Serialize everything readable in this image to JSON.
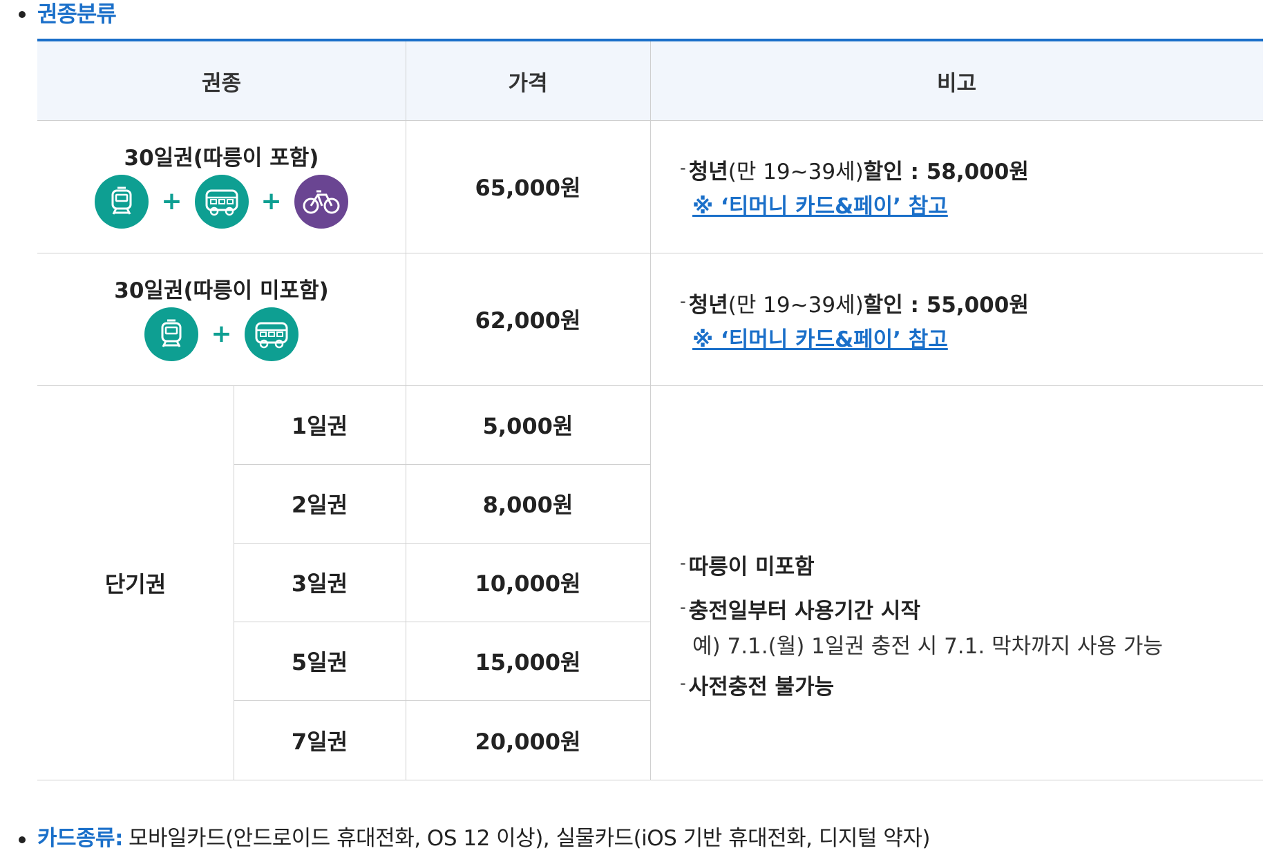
{
  "section": {
    "title": "권종분류"
  },
  "table": {
    "headers": [
      "권종",
      "가격",
      "비고"
    ],
    "rows": [
      {
        "name": "30일권(따릉이 포함)",
        "price": "65,000원",
        "icons": [
          "subway-icon",
          "bus-icon",
          "bicycle-icon"
        ],
        "note_prefix": "청년",
        "note_paren": "(만 19~39세)",
        "note_suffix": "할인 : 58,000원",
        "note_link": "※ ‘티머니 카드&페이’ 참고"
      },
      {
        "name": "30일권(따릉이 미포함)",
        "price": "62,000원",
        "icons": [
          "subway-icon",
          "bus-icon"
        ],
        "note_prefix": "청년",
        "note_paren": "(만 19~39세)",
        "note_suffix": "할인 : 55,000원",
        "note_link": "※ ‘티머니 카드&페이’ 참고"
      }
    ],
    "short_term": {
      "group_label": "단기권",
      "items": [
        {
          "name": "1일권",
          "price": "5,000원"
        },
        {
          "name": "2일권",
          "price": "8,000원"
        },
        {
          "name": "3일권",
          "price": "10,000원"
        },
        {
          "name": "5일권",
          "price": "15,000원"
        },
        {
          "name": "7일권",
          "price": "20,000원"
        }
      ],
      "notes": {
        "line1": "따릉이 미포함",
        "line2": "충전일부터 사용기간 시작",
        "line2_example": "예) 7.1.(월) 1일권 충전 시 7.1. 막차까지 사용 가능",
        "line3": "사전충전 불가능"
      }
    }
  },
  "card_types": {
    "label": "카드종류:",
    "value": "모바일카드(안드로이드 휴대전화, OS 12 이상), 실물카드(iOS 기반 휴대전화, 디지털 약자)"
  },
  "colors": {
    "accent": "#1a6fc9",
    "teal": "#0e9f92",
    "purple": "#6a4592",
    "header_bg": "#f2f6fc"
  }
}
